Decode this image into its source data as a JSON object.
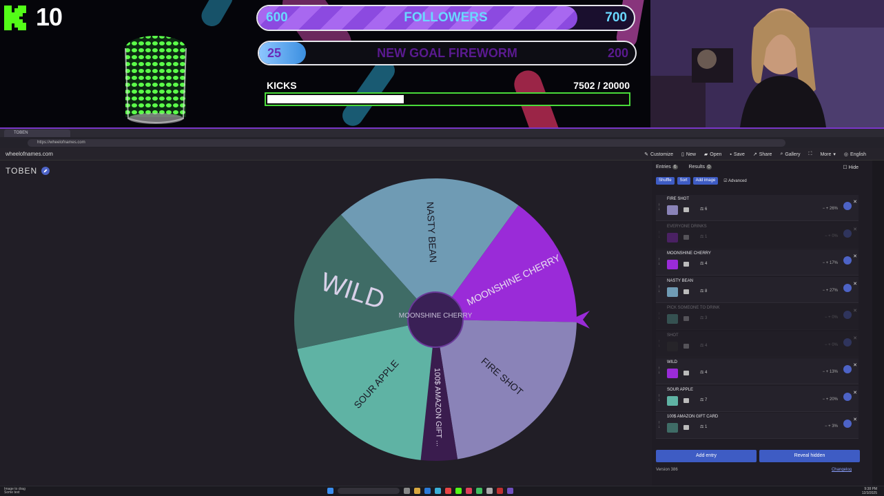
{
  "overlay": {
    "kick_count": "10",
    "followers": {
      "left": "600",
      "label": "FOLLOWERS",
      "right": "700",
      "progress_percent": 85
    },
    "fireworm": {
      "left": "25",
      "label": "NEW GOAL FIREWORM",
      "right": "200",
      "progress_percent": 12.5
    },
    "kicks": {
      "label": "KICKS",
      "value": "7502  / 20000",
      "progress_percent": 37.5
    }
  },
  "browser": {
    "tab_title": "TOBEN",
    "url": "https://wheelofnames.com",
    "site_name": "wheelofnames.com",
    "menu": [
      "Customize",
      "New",
      "Open",
      "Save",
      "Share",
      "Gallery",
      "More",
      "English"
    ]
  },
  "wheel": {
    "title": "TOBEN",
    "center_text": "MOONSHINE CHERRY",
    "slices": [
      {
        "label": "NASTY BEAN",
        "color": "#6f9bb4"
      },
      {
        "label": "MOONSHINE CHERRY",
        "color": "#9a2bd8"
      },
      {
        "label": "FIRE SHOT",
        "color": "#8a83b8"
      },
      {
        "label": "100$ AMAZON GIFT ...",
        "color": "#3a1c4e"
      },
      {
        "label": "SOUR APPLE",
        "color": "#5fb3a4"
      },
      {
        "label": "WILD",
        "color": "#3f6c66"
      }
    ],
    "pointer_color": "#9a2bd8"
  },
  "panel": {
    "tabs": [
      "Entries",
      "Results"
    ],
    "entries_count": "6",
    "results_count": "0",
    "hide_label": "Hide",
    "actions": [
      "Shuffle",
      "Sort",
      "Add image"
    ],
    "advanced_label": "Advanced",
    "entries": [
      {
        "name": "FIRE SHOT",
        "weight": "6",
        "percent": "26%",
        "color": "#8a83b8",
        "hidden": false
      },
      {
        "name": "EVERYONE DRINKS",
        "weight": "1",
        "percent": "0%",
        "color": "#9a2bd8",
        "hidden": true
      },
      {
        "name": "MOONSHINE CHERRY",
        "weight": "4",
        "percent": "17%",
        "color": "#9a2bd8",
        "hidden": false
      },
      {
        "name": "NASTY BEAN",
        "weight": "8",
        "percent": "27%",
        "color": "#6f9bb4",
        "hidden": false
      },
      {
        "name": "PICK SOMEONE TO DRINK",
        "weight": "3",
        "percent": "0%",
        "color": "#5fb3a4",
        "hidden": true
      },
      {
        "name": "SHOT",
        "weight": "4",
        "percent": "0%",
        "color": "#333",
        "hidden": true
      },
      {
        "name": "WILD",
        "weight": "4",
        "percent": "13%",
        "color": "#9a2bd8",
        "hidden": false
      },
      {
        "name": "SOUR APPLE",
        "weight": "7",
        "percent": "20%",
        "color": "#5fb3a4",
        "hidden": false
      },
      {
        "name": "100$ AMAZON GIFT CARD",
        "weight": "1",
        "percent": "3%",
        "color": "#3f6c66",
        "hidden": false
      }
    ],
    "add_entry": "Add entry",
    "reveal_hidden": "Reveal hidden",
    "version": "Version 386",
    "changelog": "Changelog"
  },
  "taskbar": {
    "left_line1": "Image to drag",
    "left_line2": "Some text",
    "time": "9:38 PM",
    "date": "12/3/2025"
  }
}
